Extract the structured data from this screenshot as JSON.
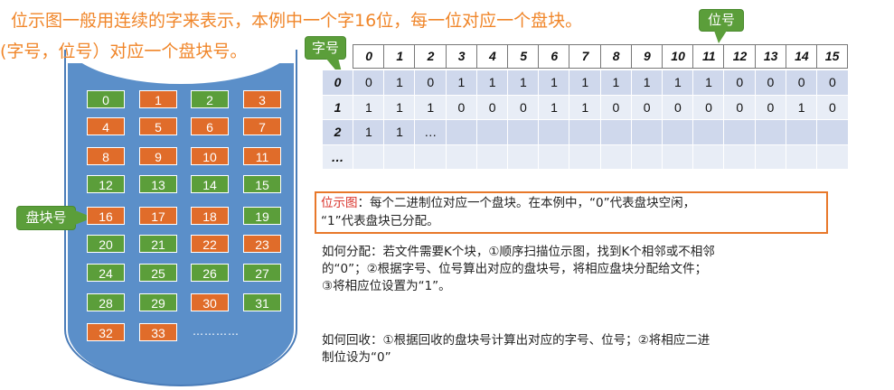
{
  "title_line1": "位示图一般用连续的字来表示，本例中一个字16位，每一位对应一个盘块。",
  "title_line2": "(字号，位号）对应一个盘块号。",
  "label_bit": "位号",
  "label_word": "字号",
  "label_block_no": "盘块号",
  "colors": {
    "green": "#5b9e3a",
    "orange": "#e06c2a",
    "disk": "#5b8fc9",
    "accent": "#f0862a",
    "box_border": "#e8782a"
  },
  "blocks": [
    {
      "n": "0",
      "c": "green"
    },
    {
      "n": "1",
      "c": "orange"
    },
    {
      "n": "2",
      "c": "green"
    },
    {
      "n": "3",
      "c": "orange"
    },
    {
      "n": "4",
      "c": "orange"
    },
    {
      "n": "5",
      "c": "orange"
    },
    {
      "n": "6",
      "c": "orange"
    },
    {
      "n": "7",
      "c": "orange"
    },
    {
      "n": "8",
      "c": "orange"
    },
    {
      "n": "9",
      "c": "orange"
    },
    {
      "n": "10",
      "c": "orange"
    },
    {
      "n": "11",
      "c": "orange"
    },
    {
      "n": "12",
      "c": "green"
    },
    {
      "n": "13",
      "c": "green"
    },
    {
      "n": "14",
      "c": "green"
    },
    {
      "n": "15",
      "c": "green"
    },
    {
      "n": "16",
      "c": "orange"
    },
    {
      "n": "17",
      "c": "orange"
    },
    {
      "n": "18",
      "c": "orange"
    },
    {
      "n": "19",
      "c": "green"
    },
    {
      "n": "20",
      "c": "green"
    },
    {
      "n": "21",
      "c": "green"
    },
    {
      "n": "22",
      "c": "orange"
    },
    {
      "n": "23",
      "c": "orange"
    },
    {
      "n": "24",
      "c": "green"
    },
    {
      "n": "25",
      "c": "green"
    },
    {
      "n": "26",
      "c": "green"
    },
    {
      "n": "27",
      "c": "green"
    },
    {
      "n": "28",
      "c": "green"
    },
    {
      "n": "29",
      "c": "green"
    },
    {
      "n": "30",
      "c": "orange"
    },
    {
      "n": "31",
      "c": "green"
    },
    {
      "n": "32",
      "c": "orange"
    },
    {
      "n": "33",
      "c": "orange"
    }
  ],
  "blocks_more": "…………",
  "bit_headers": [
    "0",
    "1",
    "2",
    "3",
    "4",
    "5",
    "6",
    "7",
    "8",
    "9",
    "10",
    "11",
    "12",
    "13",
    "14",
    "15"
  ],
  "rows": [
    {
      "word": "0",
      "bits": [
        "0",
        "1",
        "0",
        "1",
        "1",
        "1",
        "1",
        "1",
        "1",
        "1",
        "1",
        "1",
        "0",
        "0",
        "0",
        "0"
      ]
    },
    {
      "word": "1",
      "bits": [
        "1",
        "1",
        "1",
        "0",
        "0",
        "0",
        "1",
        "1",
        "0",
        "0",
        "0",
        "0",
        "0",
        "0",
        "1",
        "0"
      ]
    },
    {
      "word": "2",
      "bits": [
        "1",
        "1",
        "…",
        "",
        "",
        "",
        "",
        "",
        "",
        "",
        "",
        "",
        "",
        "",
        "",
        ""
      ]
    },
    {
      "word": "…",
      "bits": [
        "",
        "",
        "",
        "",
        "",
        "",
        "",
        "",
        "",
        "",
        "",
        "",
        "",
        "",
        "",
        ""
      ]
    }
  ],
  "def_term": "位示图",
  "def_text1": "：每个二进制位对应一个盘块。在本例中，“0”代表盘块空闲，",
  "def_text2": "“1”代表盘块已分配。",
  "alloc_lines": [
    "如何分配：若文件需要K个块，①顺序扫描位示图，找到K个相邻或不相邻",
    "的“0”；②根据字号、位号算出对应的盘块号，将相应盘块分配给文件；",
    "③将相应位设置为“1”。"
  ],
  "reclaim_lines": [
    "如何回收：①根据回收的盘块号计算出对应的字号、位号；②将相应二进",
    "制位设为“0”"
  ]
}
